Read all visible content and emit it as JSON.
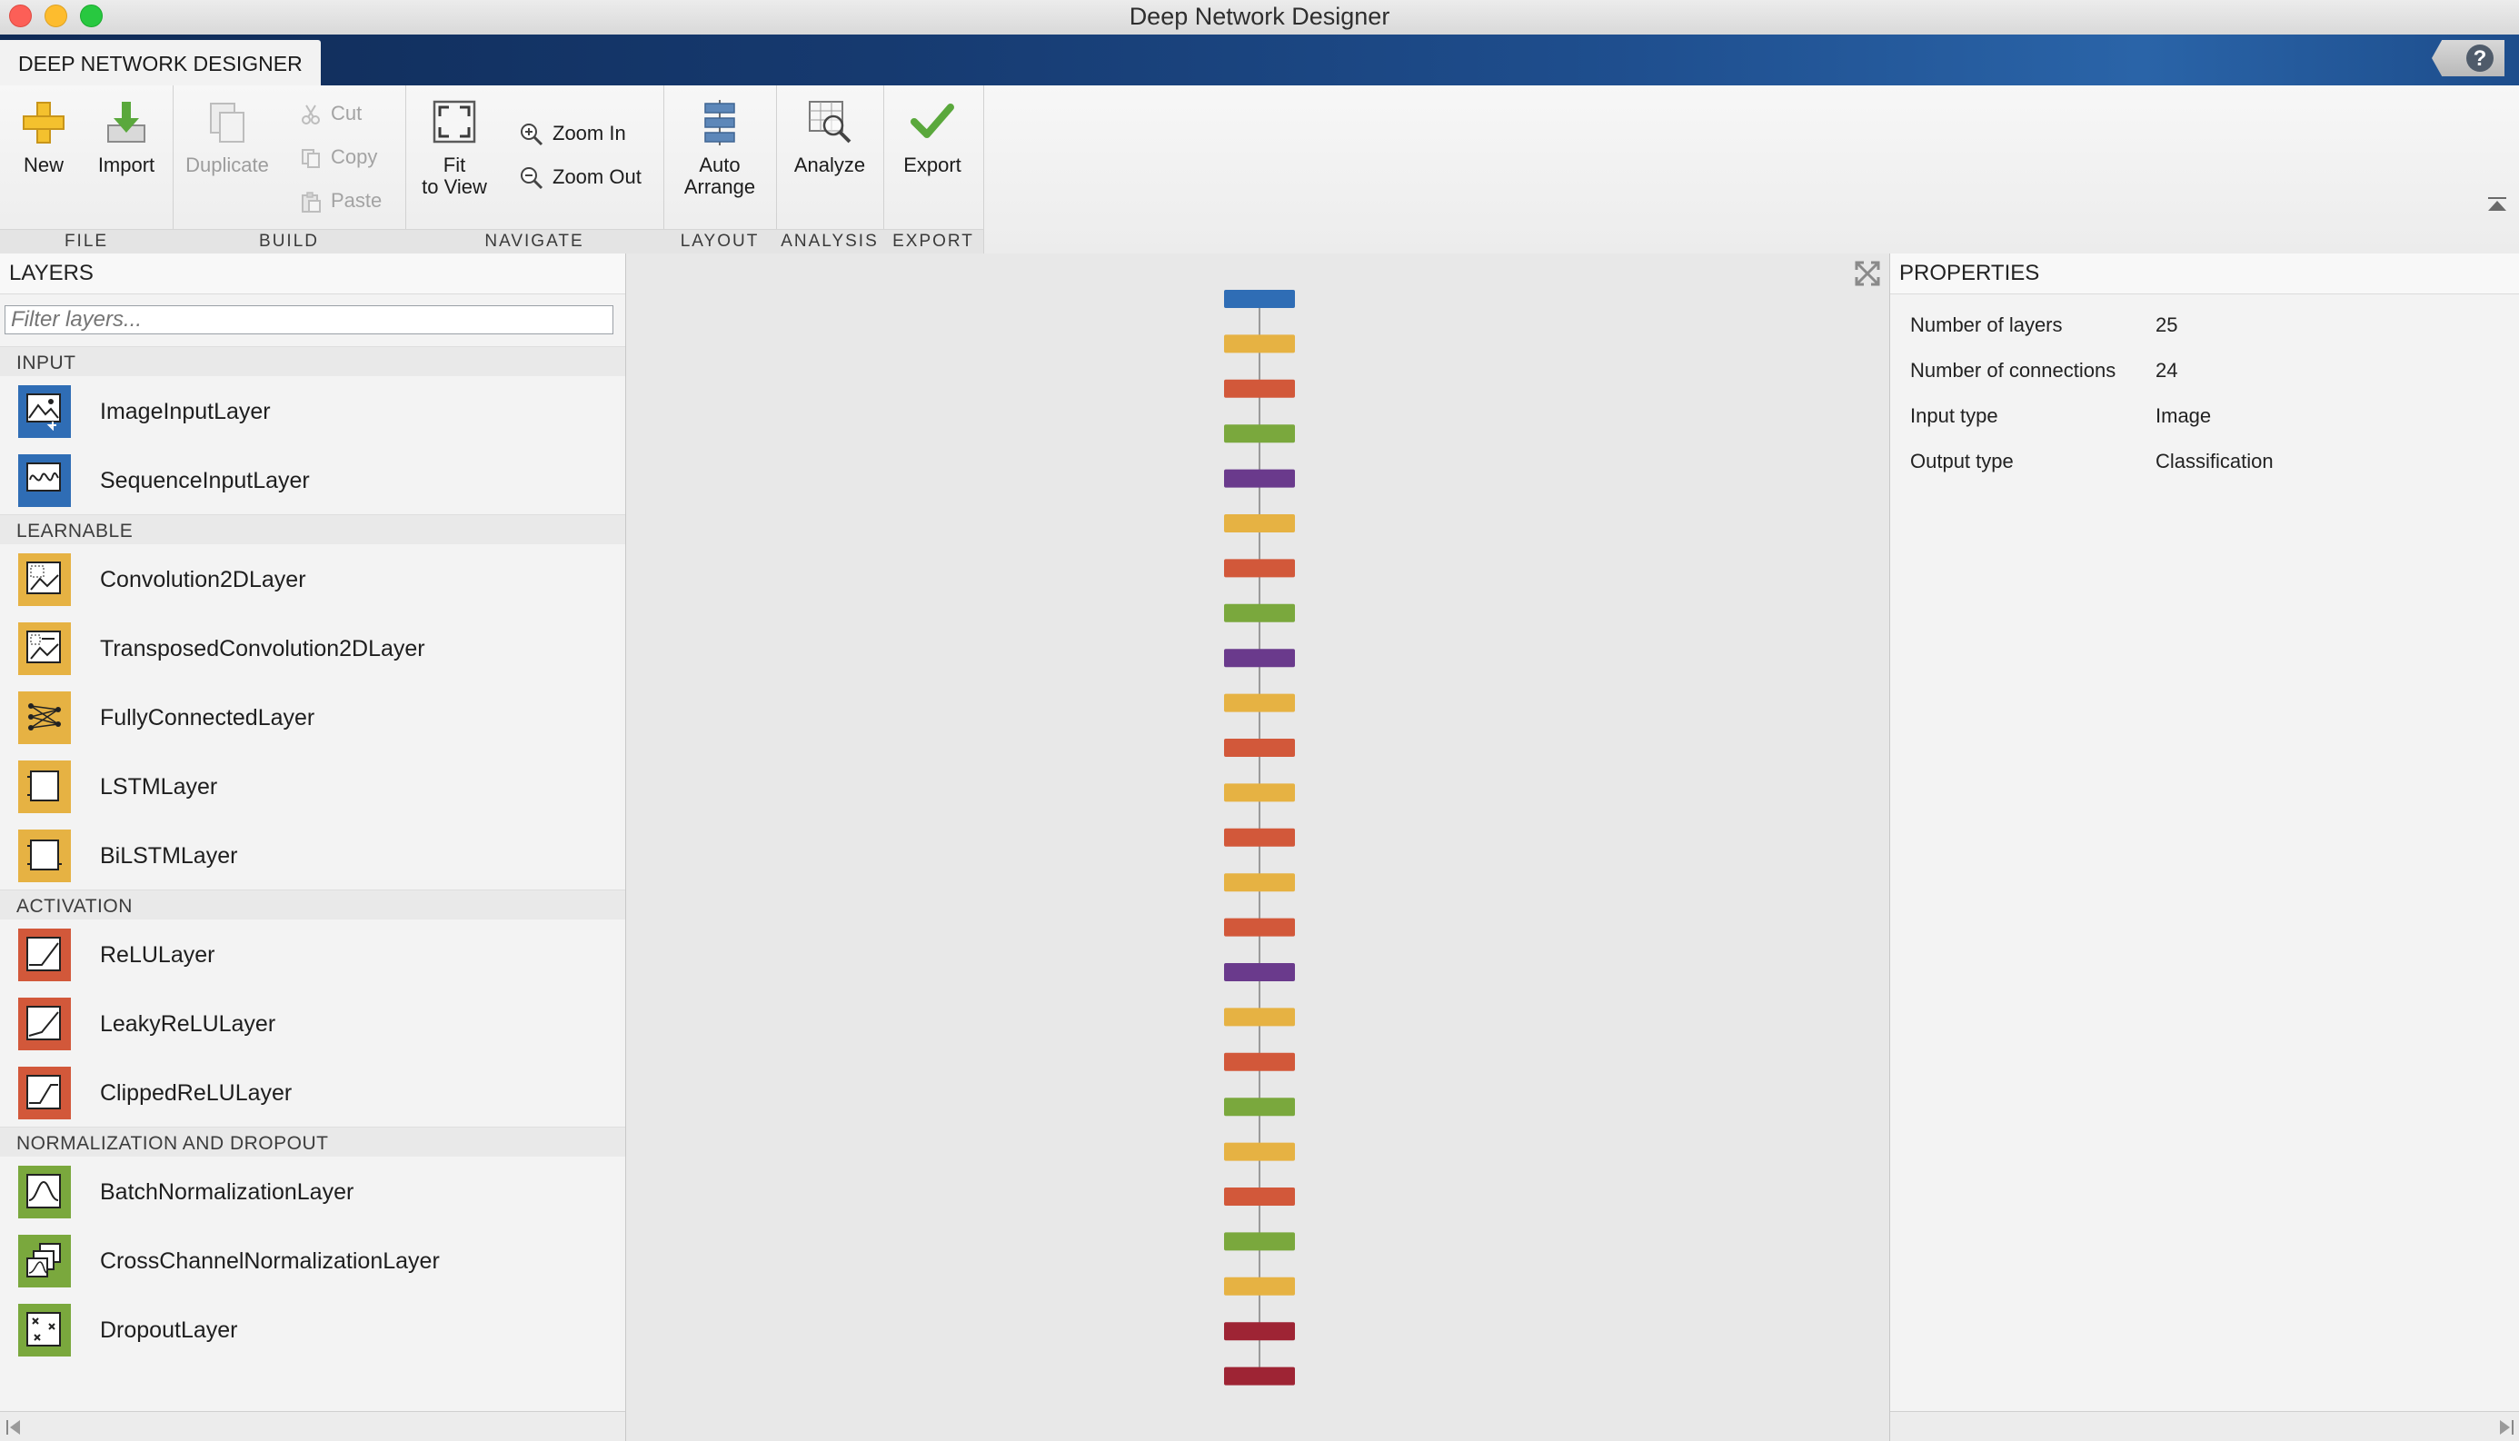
{
  "window": {
    "title": "Deep Network Designer"
  },
  "tab": {
    "label": "DEEP NETWORK DESIGNER"
  },
  "toolstrip": {
    "file": {
      "label": "FILE",
      "new": "New",
      "import": "Import"
    },
    "build": {
      "label": "BUILD",
      "duplicate": "Duplicate",
      "cut": "Cut",
      "copy": "Copy",
      "paste": "Paste"
    },
    "navigate": {
      "label": "NAVIGATE",
      "fit_line1": "Fit",
      "fit_line2": "to View",
      "zoom_in": "Zoom In",
      "zoom_out": "Zoom Out"
    },
    "layout": {
      "label": "LAYOUT",
      "auto_line1": "Auto",
      "auto_line2": "Arrange"
    },
    "analysis": {
      "label": "ANALYSIS",
      "analyze": "Analyze"
    },
    "export": {
      "label": "EXPORT",
      "export": "Export"
    }
  },
  "layers_panel": {
    "title": "LAYERS",
    "filter_placeholder": "Filter layers...",
    "categories": [
      {
        "name": "INPUT",
        "items": [
          "ImageInputLayer",
          "SequenceInputLayer"
        ]
      },
      {
        "name": "LEARNABLE",
        "items": [
          "Convolution2DLayer",
          "TransposedConvolution2DLayer",
          "FullyConnectedLayer",
          "LSTMLayer",
          "BiLSTMLayer"
        ]
      },
      {
        "name": "ACTIVATION",
        "items": [
          "ReLULayer",
          "LeakyReLULayer",
          "ClippedReLULayer"
        ]
      },
      {
        "name": "NORMALIZATION AND DROPOUT",
        "items": [
          "BatchNormalizationLayer",
          "CrossChannelNormalizationLayer",
          "DropoutLayer"
        ]
      }
    ]
  },
  "network": {
    "colors": {
      "input": "#2f6db5",
      "conv": "#e6b243",
      "relu": "#d2583a",
      "norm": "#7aa83d",
      "pool": "#6a3a8c",
      "output": "#9e2434"
    },
    "layers": [
      "input",
      "conv",
      "relu",
      "norm",
      "pool",
      "conv",
      "relu",
      "norm",
      "pool",
      "conv",
      "relu",
      "conv",
      "relu",
      "conv",
      "relu",
      "pool",
      "conv",
      "relu",
      "norm",
      "conv",
      "relu",
      "norm",
      "conv",
      "output",
      "output"
    ]
  },
  "properties": {
    "title": "PROPERTIES",
    "rows": [
      {
        "label": "Number of layers",
        "value": "25"
      },
      {
        "label": "Number of connections",
        "value": "24"
      },
      {
        "label": "Input type",
        "value": "Image"
      },
      {
        "label": "Output type",
        "value": "Classification"
      }
    ]
  }
}
